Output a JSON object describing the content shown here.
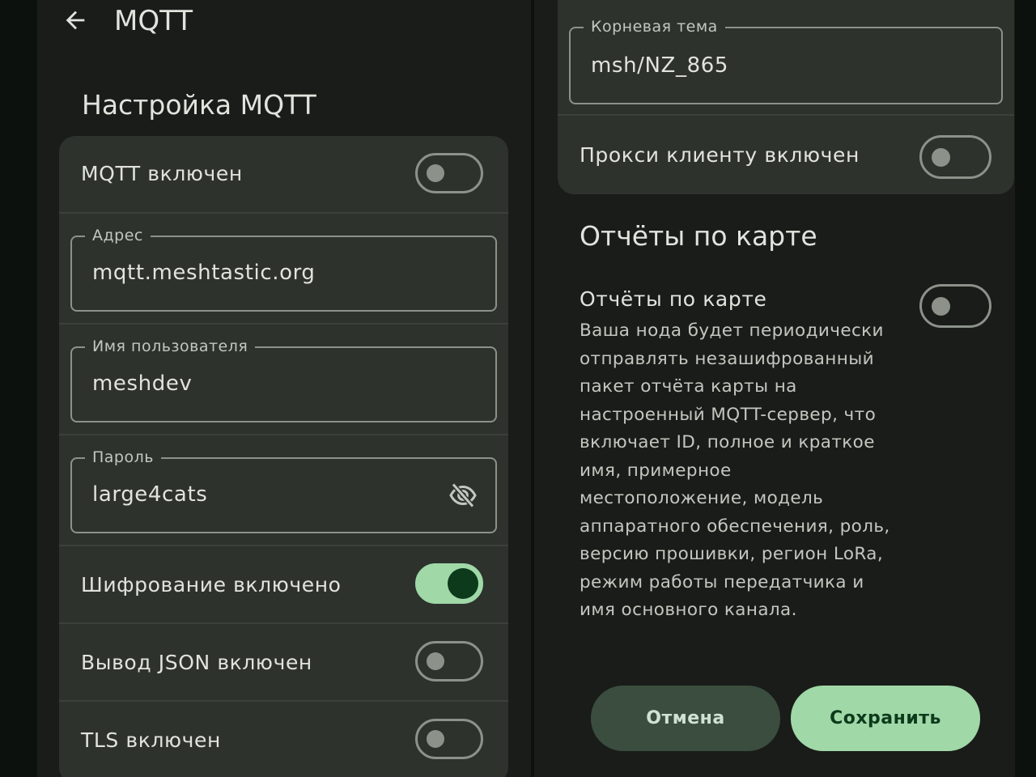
{
  "left": {
    "topbar": {
      "title": "MQTT"
    },
    "section_title": "Настройка MQTT",
    "toggles": {
      "mqtt_enabled": {
        "label": "MQTT включен",
        "on": false
      },
      "encryption_enabled": {
        "label": "Шифрование включено",
        "on": true
      },
      "json_enabled": {
        "label": "Вывод JSON включен",
        "on": false
      },
      "tls_enabled": {
        "label": "TLS включен",
        "on": false
      }
    },
    "fields": {
      "address": {
        "label": "Адрес",
        "value": "mqtt.meshtastic.org"
      },
      "username": {
        "label": "Имя пользователя",
        "value": "meshdev"
      },
      "password": {
        "label": "Пароль",
        "value": "large4cats"
      }
    }
  },
  "right": {
    "fields": {
      "root_topic": {
        "label": "Корневая тема",
        "value": "msh/NZ_865"
      }
    },
    "toggles": {
      "proxy_to_client": {
        "label": "Прокси клиенту включен",
        "on": false
      },
      "map_reports": {
        "label": "Отчёты по карте",
        "on": false
      }
    },
    "map_section_title": "Отчёты по карте",
    "map_reports_description": "Ваша нода будет периодически отправлять незашифрованный пакет отчёта карты на настроенный MQTT-сервер, что включает ID, полное и краткое имя, примерное местоположение, модель аппаратного обеспечения, роль, версию прошивки, регион LoRa, режим работы передатчика и имя основного канала.",
    "buttons": {
      "cancel": "Отмена",
      "save": "Сохранить"
    }
  },
  "icons": {
    "back": "arrow-back-icon",
    "password_visibility": "visibility-off-icon"
  },
  "colors": {
    "screen_background": "#1a1c19",
    "card_background": "#2d322d",
    "accent": "#a0d8a8",
    "accent_dark": "#0d3a1b",
    "outline": "#8c928a",
    "cancel_button": "#3a4d3e"
  }
}
